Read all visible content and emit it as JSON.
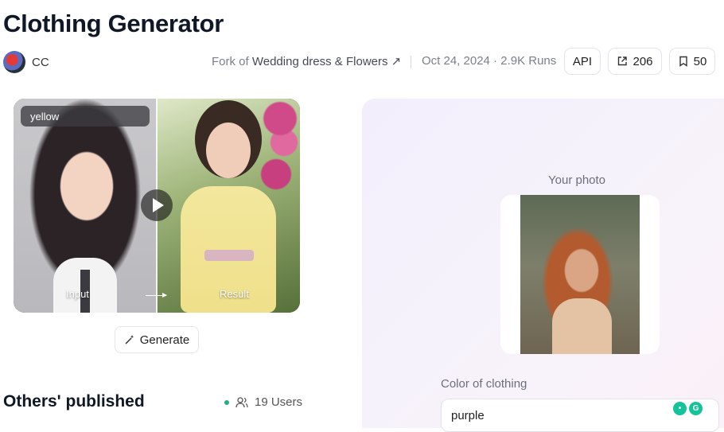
{
  "header": {
    "title": "Clothing Generator",
    "author": "CC",
    "fork_prefix": "Fork of",
    "fork_name": "Wedding dress & Flowers ↗",
    "date_runs": "Oct 24, 2024 · 2.9K Runs",
    "api_label": "API",
    "share_count": "206",
    "bookmark_count": "50"
  },
  "preview": {
    "prompt_chip": "yellow",
    "input_caption": "Input",
    "result_caption": "Result"
  },
  "generate_label": "Generate",
  "others": {
    "title": "Others' published",
    "users": "19 Users"
  },
  "form": {
    "photo_label": "Your photo",
    "color_label": "Color of clothing",
    "color_value": "purple"
  },
  "colors": {
    "accent_green": "#22b07d",
    "panel_bg": "#f2eefc"
  }
}
